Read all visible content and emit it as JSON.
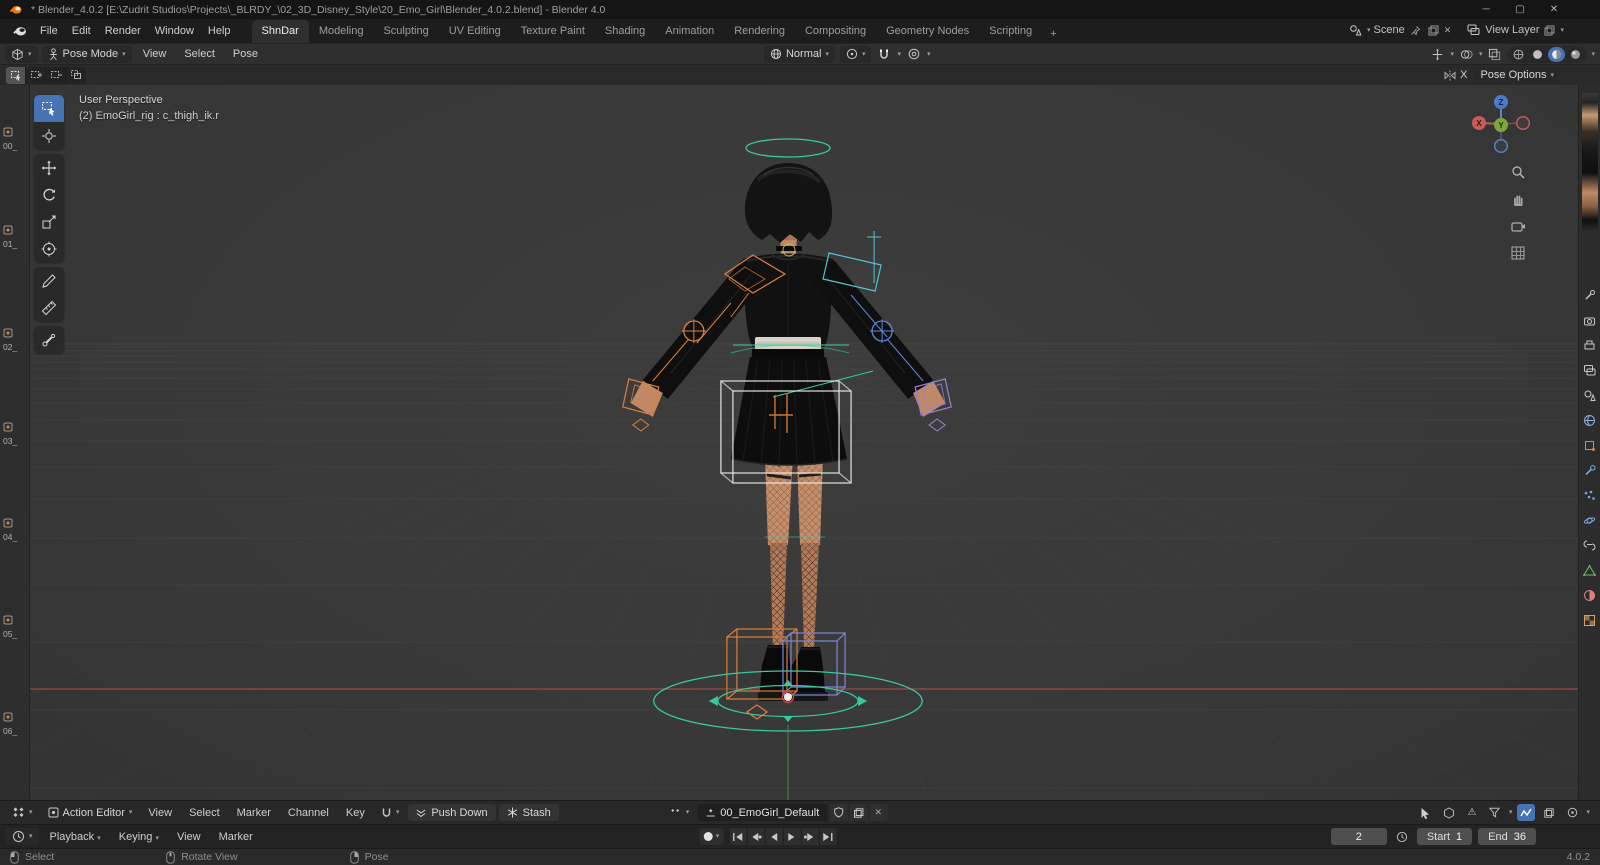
{
  "icons": {
    "chevron_down": "▾",
    "close": "✕",
    "minimize": "─",
    "maximize": "▢",
    "warning": "⚠"
  },
  "colors": {
    "accent": "#4772b3",
    "axis_x": "#d05c5c",
    "axis_y": "#7fae3c",
    "axis_z": "#4a7fd0",
    "rig_teal": "#39c9a0",
    "rig_orange": "#dd7f3b",
    "rig_blue": "#5f86d8",
    "rig_purple": "#9b7fd8"
  },
  "titlebar": {
    "title": "* Blender_4.0.2 [E:\\Zudrit Studios\\Projects\\_BLRDY_\\02_3D_Disney_Style\\20_Emo_Girl\\Blender_4.0.2.blend] - Blender 4.0"
  },
  "topbar": {
    "menus": [
      "File",
      "Edit",
      "Render",
      "Window",
      "Help"
    ],
    "workspaces": [
      "ShnDar",
      "Modeling",
      "Sculpting",
      "UV Editing",
      "Texture Paint",
      "Shading",
      "Animation",
      "Rendering",
      "Compositing",
      "Geometry Nodes",
      "Scripting"
    ],
    "active_workspace": "ShnDar",
    "add_workspace": "+",
    "scene_label": "Scene",
    "view_layer_label": "View Layer"
  },
  "viewport_header": {
    "mode": "Pose Mode",
    "menus": [
      "View",
      "Select",
      "Pose"
    ],
    "orientation": "Normal"
  },
  "tool_settings": {
    "mirror_axis": "X",
    "pose_options": "Pose Options"
  },
  "viewport": {
    "overlay_line1": "User Perspective",
    "overlay_line2": "(2) EmoGirl_rig : c_thigh_ik.r",
    "gizmo": {
      "x": "X",
      "y": "Y",
      "z": "Z"
    }
  },
  "left_strip": {
    "items": [
      "00_",
      "01_",
      "02_",
      "03_",
      "04_",
      "05_",
      "06_"
    ]
  },
  "dope_sheet": {
    "editor_mode": "Action Editor",
    "menus": [
      "View",
      "Select",
      "Marker",
      "Channel",
      "Key"
    ],
    "push_down": "Push Down",
    "stash": "Stash",
    "action_name": "00_EmoGirl_Default"
  },
  "timeline": {
    "menus": [
      "Playback",
      "Keying",
      "View",
      "Marker"
    ],
    "current_frame": "2",
    "start_label": "Start",
    "start_value": "1",
    "end_label": "End",
    "end_value": "36"
  },
  "status_bar": {
    "left_click": "Select",
    "middle_click": "Rotate View",
    "right_click": "Pose",
    "version": "4.0.2"
  }
}
